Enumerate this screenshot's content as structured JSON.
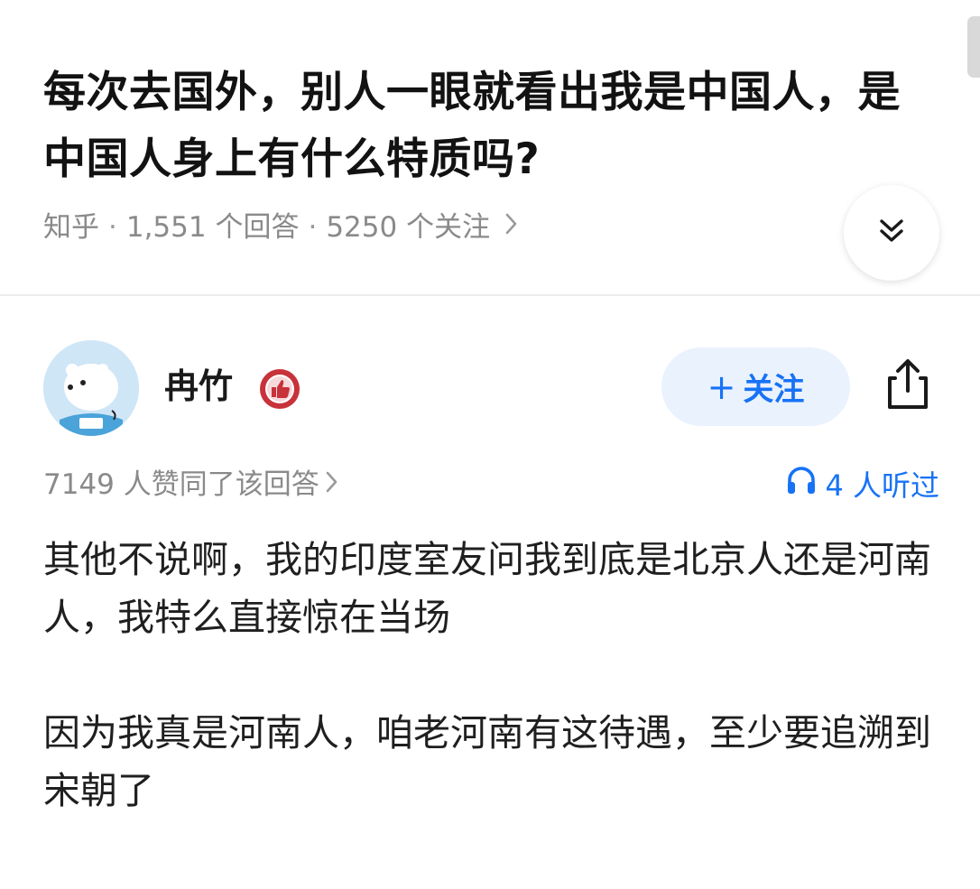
{
  "question": {
    "title": "每次去国外，别人一眼就看出我是中国人，是中国人身上有什么特质吗?",
    "source": "知乎",
    "answer_count": "1,551 个回答",
    "follower_count": "5250 个关注",
    "separator": "·"
  },
  "answer": {
    "author_name": "冉竹",
    "follow_label": "关注",
    "upvote_text": "7149 人赞同了该回答",
    "listened_text": "4 人听过",
    "paragraphs": [
      "其他不说啊，我的印度室友问我到底是北京人还是河南人，我特么直接惊在当场",
      "因为我真是河南人，咱老河南有这待遇，至少要追溯到宋朝了"
    ]
  },
  "icons": {
    "expand": "double-chevron-down-icon",
    "share": "share-icon",
    "listen": "headphones-icon",
    "badge": "thumbs-up-badge-icon",
    "chevron": "chevron-right-icon"
  },
  "colors": {
    "accent": "#1772f6",
    "follow_bg": "#eaf2fd",
    "muted": "#8a8a8a",
    "badge_red": "#c8323a"
  }
}
